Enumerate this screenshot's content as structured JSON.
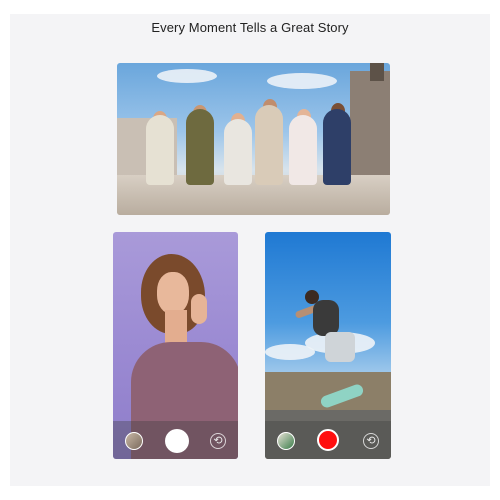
{
  "header": {
    "title": "Every Moment Tells a Great Story"
  },
  "colors": {
    "background": "#f4f4f6",
    "video_shutter": "#ff0f0f",
    "photo_shutter": "#ffffff"
  },
  "icons": {
    "gallery_thumb": "gallery-thumbnail-icon",
    "switch_camera": "camera-switch-icon",
    "switch_glyph": "⟲"
  },
  "screens": [
    {
      "mode": "photo"
    },
    {
      "mode": "video"
    }
  ]
}
